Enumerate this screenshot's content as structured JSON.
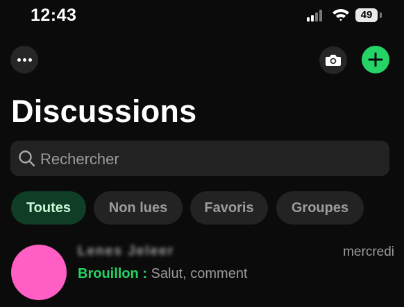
{
  "status_bar": {
    "time": "12:43",
    "battery": "49"
  },
  "header": {
    "title": "Discussions",
    "add_button_color": "#25d366"
  },
  "search": {
    "placeholder": "Rechercher"
  },
  "filters": [
    {
      "label": "Toutes",
      "active": true
    },
    {
      "label": "Non lues",
      "active": false
    },
    {
      "label": "Favoris",
      "active": false
    },
    {
      "label": "Groupes",
      "active": false
    }
  ],
  "chats": [
    {
      "name": "Lenes Jeleer",
      "time": "mercredi",
      "draft_label": "Brouillon :",
      "preview": "Salut, comment",
      "avatar_color": "#ff5ec4"
    }
  ]
}
